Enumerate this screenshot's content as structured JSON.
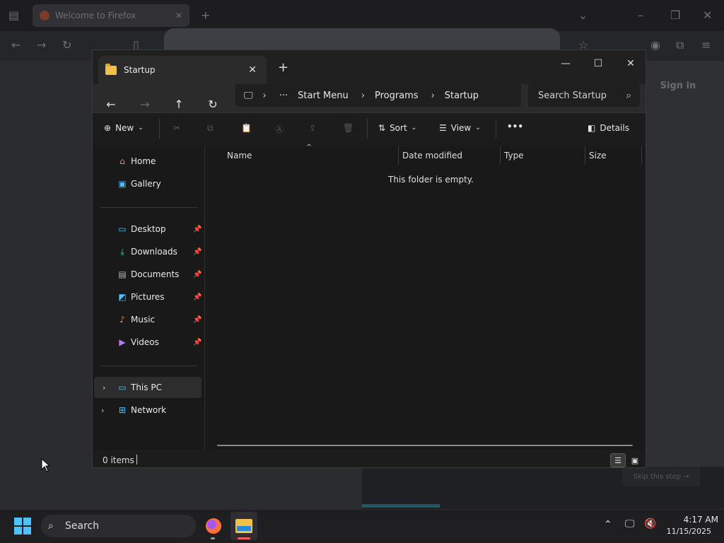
{
  "firefox": {
    "tab_title": "Welcome to Firefox",
    "sign_in": "Sign in",
    "skip": "Skip this step"
  },
  "explorer": {
    "tab_title": "Startup",
    "address": {
      "segments": [
        "Start Menu",
        "Programs",
        "Startup"
      ]
    },
    "search_placeholder": "Search Startup",
    "commands": {
      "new": "New",
      "sort": "Sort",
      "view": "View",
      "details": "Details"
    },
    "sidebar": {
      "items": [
        {
          "label": "Home",
          "icon": "home-icon"
        },
        {
          "label": "Gallery",
          "icon": "gallery-icon"
        },
        {
          "label": "Desktop",
          "icon": "desktop-icon"
        },
        {
          "label": "Downloads",
          "icon": "download-icon"
        },
        {
          "label": "Documents",
          "icon": "document-icon"
        },
        {
          "label": "Pictures",
          "icon": "picture-icon"
        },
        {
          "label": "Music",
          "icon": "music-icon"
        },
        {
          "label": "Videos",
          "icon": "video-icon"
        },
        {
          "label": "This PC",
          "icon": "computer-icon"
        },
        {
          "label": "Network",
          "icon": "network-icon"
        }
      ]
    },
    "columns": [
      "Name",
      "Date modified",
      "Type",
      "Size"
    ],
    "empty_message": "This folder is empty.",
    "status": "0 items"
  },
  "taskbar": {
    "search_label": "Search",
    "time": "4:17 AM",
    "date": "11/15/2025"
  },
  "colors": {
    "accent": "#4cc2ff",
    "folder": "#f0c24a"
  }
}
